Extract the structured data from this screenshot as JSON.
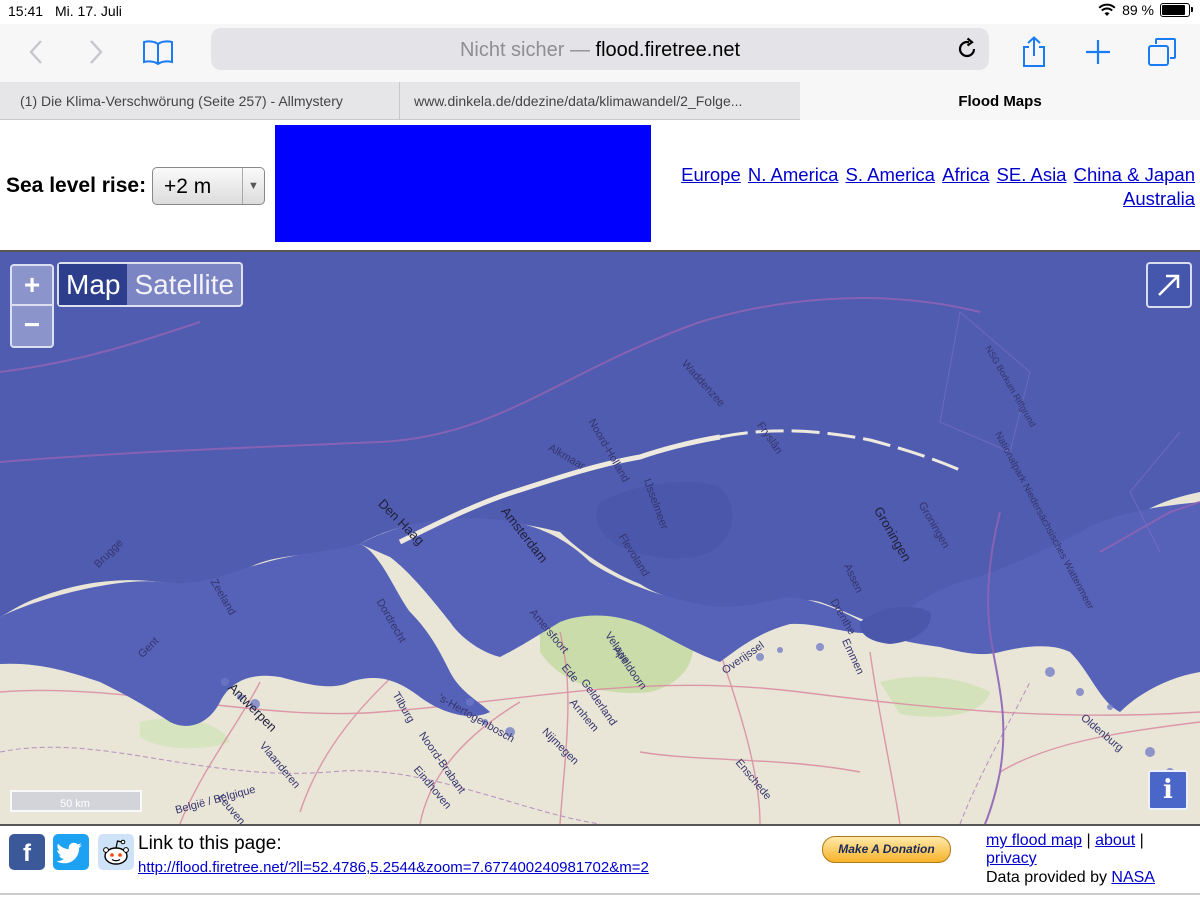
{
  "status": {
    "time": "15:41",
    "date": "Mi. 17. Juli",
    "battery": "89 %",
    "battery_level": 0.89
  },
  "toolbar": {
    "url_prefix": "Nicht sicher — ",
    "url_host": "flood.firetree.net"
  },
  "tabs": [
    {
      "label": "(1) Die Klima-Verschwörung (Seite 257) - Allmystery"
    },
    {
      "label": "www.dinkela.de/ddezine/data/klimawandel/2_Folge..."
    },
    {
      "label": "Flood Maps"
    }
  ],
  "controls": {
    "sea_level_label": "Sea level rise:",
    "sea_level_value": "+2 m"
  },
  "regions": [
    {
      "label": "Europe"
    },
    {
      "label": "N. America"
    },
    {
      "label": "S. America"
    },
    {
      "label": "Africa"
    },
    {
      "label": "SE. Asia"
    },
    {
      "label": "China & Japan"
    },
    {
      "label": "Australia"
    }
  ],
  "map": {
    "zoom_in": "+",
    "zoom_out": "−",
    "map_type_map": "Map",
    "map_type_satellite": "Satellite",
    "scale": "50 km",
    "info": "i",
    "labels": {
      "waddenzee": "Waddenzee",
      "noord_holland": "Noord-Holland",
      "amsterdam": "Amsterdam",
      "den_haag": "Den Haag",
      "groningen": "Groningen",
      "groningen_prov": "Groningen",
      "friesland": "Friesland",
      "flevoland": "Flevoland",
      "ijsselmeer": "IJsselmeer",
      "drenthe": "Drenthe",
      "assen": "Assen",
      "emmen": "Emmen",
      "apeldoorn": "Apeldoorn",
      "arnhem": "Arnhem",
      "nijmegen": "Nijmegen",
      "enschede": "Enschede",
      "tilburg": "Tilburg",
      "antwerpen": "Antwerpen",
      "eindhoven": "Eindhoven",
      "noord_brabant": "Noord-Brabant",
      "gelderland": "Gelderland",
      "overijssel": "Overijssel",
      "veluwe": "Veluwe",
      "oldenburg": "Oldenburg",
      "vlaanderen": "Vlaanderen",
      "leuven": "Leuven",
      "belgie": "België / Belgique",
      "nationalpark": "Nationalpark Niedersächsisches Wattenmeer",
      "nsg": "NSG Borkum Riffgrund",
      "den_bosch": "'s-Hertogenbosch",
      "zeeland": "Zeeland",
      "brugge": "Brugge",
      "gent": "Gent",
      "alkmaar": "Alkmaar",
      "amersfoort": "Amersfoort",
      "dordrecht": "Dordrecht",
      "ede": "Ede",
      "friesland2": "Fryslân"
    }
  },
  "footer": {
    "facebook": "f",
    "link_label": "Link to this page:",
    "permalink": "http://flood.firetree.net/?ll=52.4786,5.2544&zoom=7.677400240981702&m=2",
    "donate": "Make A Donation",
    "my_flood_map": "my flood map",
    "about": "about",
    "privacy": "privacy",
    "sep": "|",
    "data_provided": "Data provided by ",
    "nasa": "NASA"
  },
  "colors": {
    "flood": "#5562b8",
    "sea": "#4f5cb0",
    "land": "#e9e5d7",
    "ad": "#0000ff",
    "link": "#0000cc"
  }
}
